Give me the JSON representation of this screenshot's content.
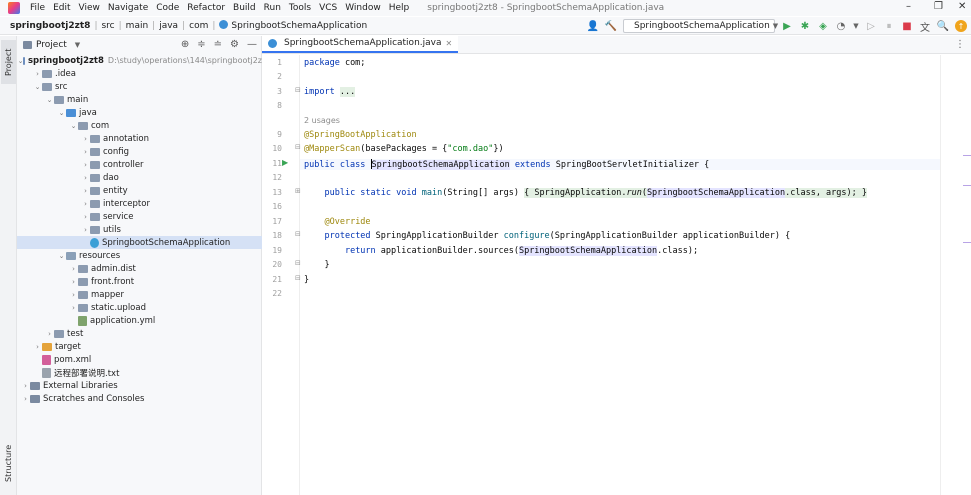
{
  "menu": {
    "items": [
      "File",
      "Edit",
      "View",
      "Navigate",
      "Code",
      "Refactor",
      "Build",
      "Run",
      "Tools",
      "VCS",
      "Window",
      "Help"
    ],
    "window_title": "springbootj2zt8 - SpringbootSchemaApplication.java"
  },
  "window_controls": {
    "minimize": "–",
    "restore": "❐",
    "close": "✕"
  },
  "breadcrumb": [
    "springbootj2zt8",
    "src",
    "main",
    "java",
    "com",
    "SpringbootSchemaApplication"
  ],
  "toolbar": {
    "run_config": "SpringbootSchemaApplication"
  },
  "left_strip": {
    "top_tab": "Project",
    "bottom_tab": "Structure"
  },
  "project_panel": {
    "title": "Project",
    "tree": [
      {
        "level": 0,
        "arrow": "v",
        "kind": "module",
        "label": "springbootj2zt8",
        "hint": "D:\\study\\operations\\144\\springbootj2z"
      },
      {
        "level": 1,
        "arrow": ">",
        "kind": "folder",
        "label": ".idea"
      },
      {
        "level": 1,
        "arrow": "v",
        "kind": "folder",
        "label": "src"
      },
      {
        "level": 2,
        "arrow": "v",
        "kind": "folder",
        "label": "main"
      },
      {
        "level": 3,
        "arrow": "v",
        "kind": "java",
        "label": "java"
      },
      {
        "level": 4,
        "arrow": "v",
        "kind": "folder",
        "label": "com"
      },
      {
        "level": 5,
        "arrow": ">",
        "kind": "folder",
        "label": "annotation"
      },
      {
        "level": 5,
        "arrow": ">",
        "kind": "folder",
        "label": "config"
      },
      {
        "level": 5,
        "arrow": ">",
        "kind": "folder",
        "label": "controller"
      },
      {
        "level": 5,
        "arrow": ">",
        "kind": "folder",
        "label": "dao"
      },
      {
        "level": 5,
        "arrow": ">",
        "kind": "folder",
        "label": "entity"
      },
      {
        "level": 5,
        "arrow": ">",
        "kind": "folder",
        "label": "interceptor"
      },
      {
        "level": 5,
        "arrow": ">",
        "kind": "folder",
        "label": "service"
      },
      {
        "level": 5,
        "arrow": ">",
        "kind": "folder",
        "label": "utils"
      },
      {
        "level": 5,
        "arrow": "",
        "kind": "java-file",
        "label": "SpringbootSchemaApplication",
        "selected": true
      },
      {
        "level": 3,
        "arrow": "v",
        "kind": "res",
        "label": "resources"
      },
      {
        "level": 4,
        "arrow": ">",
        "kind": "folder",
        "label": "admin.dist"
      },
      {
        "level": 4,
        "arrow": ">",
        "kind": "folder",
        "label": "front.front"
      },
      {
        "level": 4,
        "arrow": ">",
        "kind": "folder",
        "label": "mapper"
      },
      {
        "level": 4,
        "arrow": ">",
        "kind": "folder",
        "label": "static.upload"
      },
      {
        "level": 4,
        "arrow": "",
        "kind": "yml-file",
        "label": "application.yml"
      },
      {
        "level": 2,
        "arrow": ">",
        "kind": "folder",
        "label": "test"
      },
      {
        "level": 1,
        "arrow": ">",
        "kind": "target",
        "label": "target"
      },
      {
        "level": 1,
        "arrow": "",
        "kind": "xml-file",
        "label": "pom.xml"
      },
      {
        "level": 1,
        "arrow": "",
        "kind": "txt-file",
        "label": "远程部署说明.txt"
      },
      {
        "level": 0,
        "arrow": ">",
        "kind": "lib",
        "label": "External Libraries"
      },
      {
        "level": 0,
        "arrow": ">",
        "kind": "lib",
        "label": "Scratches and Consoles"
      }
    ]
  },
  "editor": {
    "tab": {
      "label": "SpringbootSchemaApplication.java"
    },
    "line_numbers": [
      "1",
      "2",
      "3",
      "8",
      "9",
      "10",
      "11",
      "12",
      "13",
      "16",
      "17",
      "18",
      "19",
      "20",
      "21",
      "22"
    ],
    "usages_hint": "2 usages",
    "code": {
      "package_kw": "package",
      "package_name": " com;",
      "import_kw": "import",
      "import_fold": "...",
      "ann1": "@SpringBootApplication",
      "ann2_name": "@MapperScan",
      "ann2_args_a": "(basePackages = {",
      "ann2_str": "\"com.dao\"",
      "ann2_args_b": "})",
      "l11_kw": "public class ",
      "l11_cls": "SpringbootSchemaApplication",
      "l11_ext": " extends ",
      "l11_parent": "SpringBootServletInitializer",
      "l11_brace": " {",
      "l13_kw": "public static void ",
      "l13_mth": "main",
      "l13_args": "(String[] args) ",
      "l13_body_a": "{ SpringApplication.",
      "l13_run": "run",
      "l13_body_b": "(",
      "l13_cls": "SpringbootSchemaApplication",
      "l13_body_c": ".class, args); }",
      "l17_ann": "@Override",
      "l18_kw": "protected ",
      "l18_type": "SpringApplicationBuilder ",
      "l18_mth": "configure",
      "l18_args": "(SpringApplicationBuilder applicationBuilder) {",
      "l19_kw": "return ",
      "l19_body_a": "applicationBuilder.sources(",
      "l19_cls": "SpringbootSchemaApplication",
      "l19_body_b": ".class);",
      "l20": "}",
      "l21": "}"
    }
  }
}
